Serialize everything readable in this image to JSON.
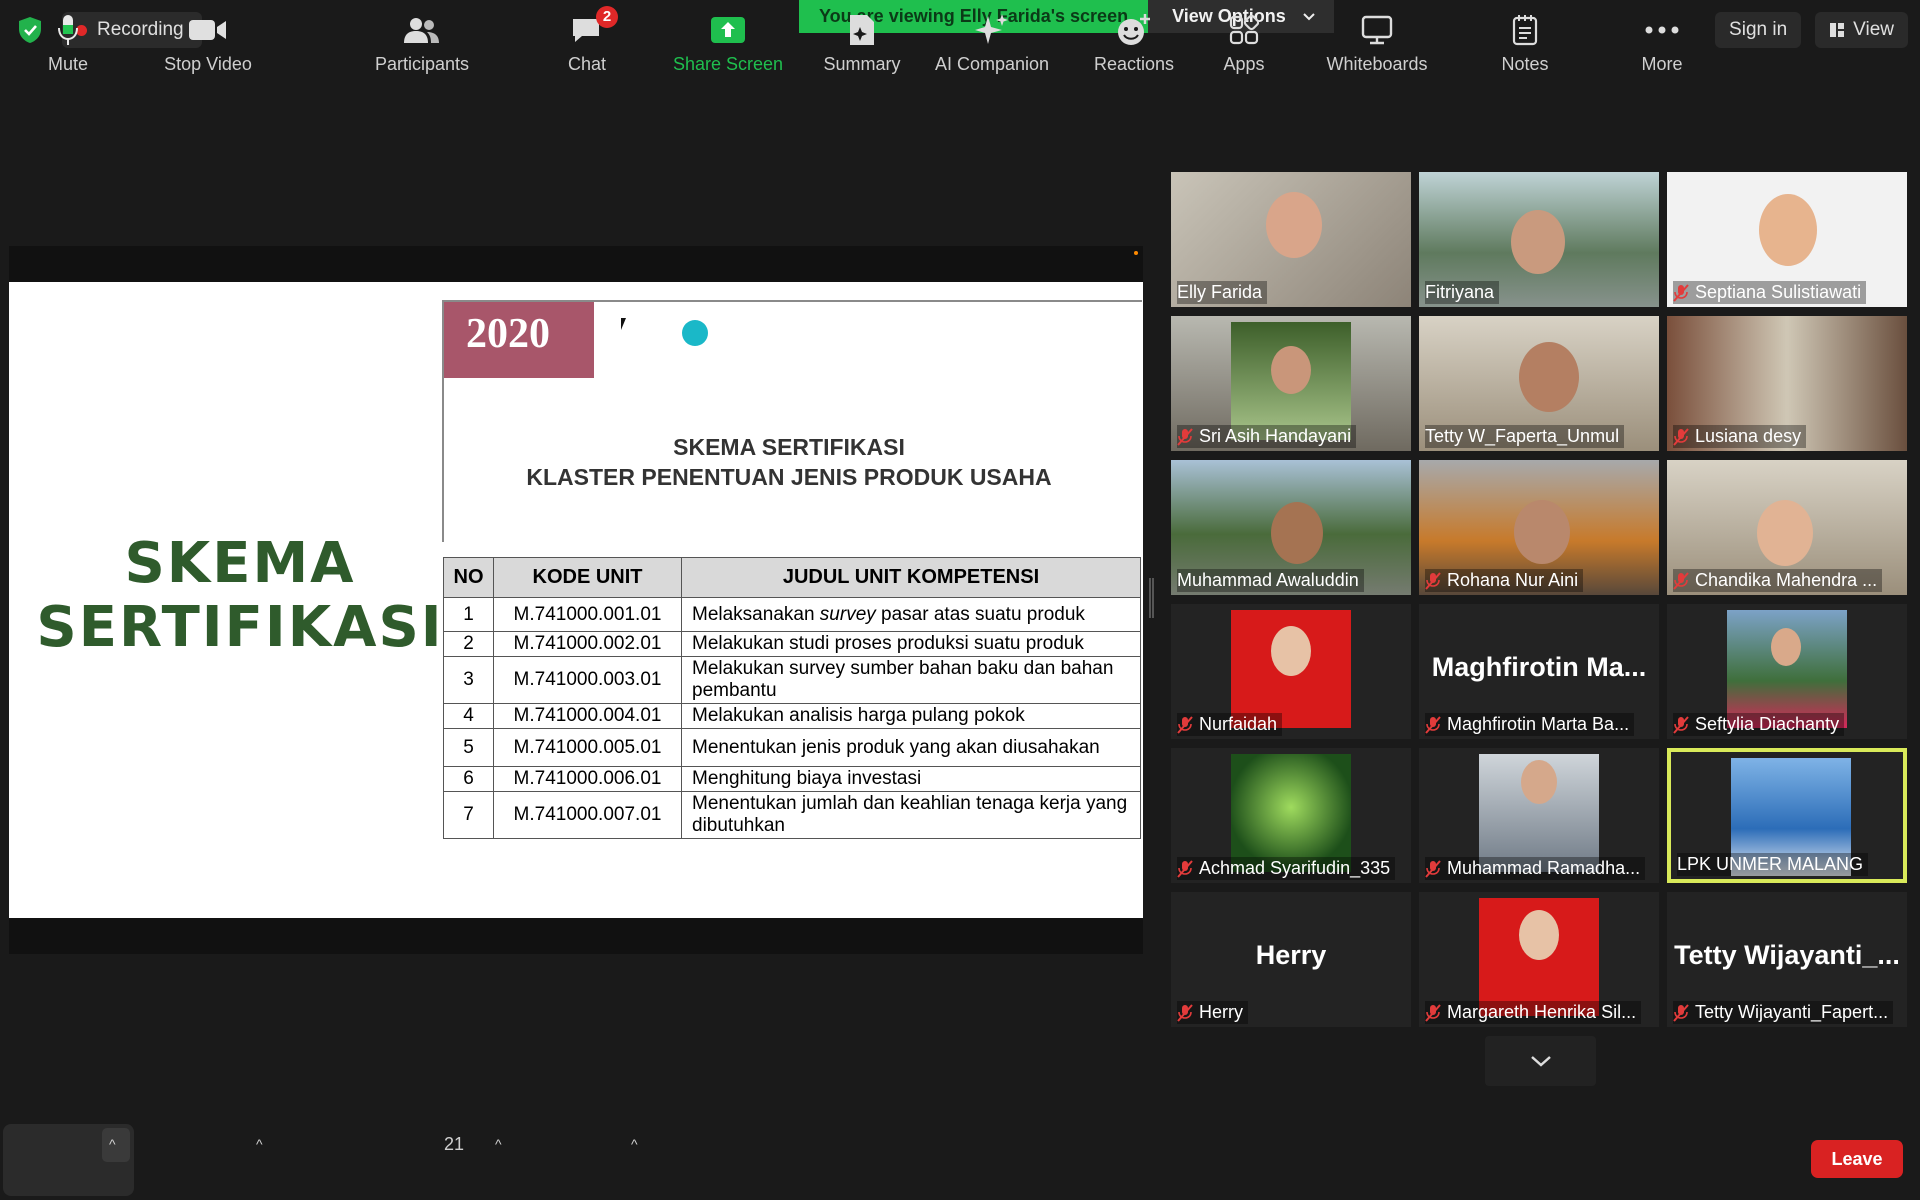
{
  "top": {
    "recording_label": "Recording",
    "banner_text": "You are viewing Elly Farida's screen",
    "view_options_label": "View Options",
    "sign_in_label": "Sign in",
    "view_label": "View"
  },
  "slide": {
    "big_title_line1": "SKEMA",
    "big_title_line2": "SERTIFIKASI",
    "year": "2020",
    "heading_line1": "SKEMA SERTIFIKASI",
    "heading_line2": "KLASTER PENENTUAN JENIS PRODUK USAHA",
    "table_headers": [
      "NO",
      "KODE UNIT",
      "JUDUL UNIT KOMPETENSI"
    ],
    "rows": [
      {
        "no": "1",
        "kode": "M.741000.001.01",
        "judul_pre": "Melaksanakan ",
        "judul_em": "survey",
        "judul_post": " pasar atas suatu produk"
      },
      {
        "no": "2",
        "kode": "M.741000.002.01",
        "judul_pre": "Melakukan studi proses produksi suatu produk",
        "judul_em": "",
        "judul_post": ""
      },
      {
        "no": "3",
        "kode": "M.741000.003.01",
        "judul_pre": "Melakukan survey sumber bahan baku dan bahan pembantu",
        "judul_em": "",
        "judul_post": ""
      },
      {
        "no": "4",
        "kode": "M.741000.004.01",
        "judul_pre": "Melakukan analisis harga pulang pokok",
        "judul_em": "",
        "judul_post": ""
      },
      {
        "no": "5",
        "kode": "M.741000.005.01",
        "judul_pre": "Menentukan jenis produk yang akan diusahakan",
        "judul_em": "",
        "judul_post": ""
      },
      {
        "no": "6",
        "kode": "M.741000.006.01",
        "judul_pre": "Menghitung biaya investasi",
        "judul_em": "",
        "judul_post": ""
      },
      {
        "no": "7",
        "kode": "M.741000.007.01",
        "judul_pre": "Menentukan jumlah dan keahlian tenaga kerja yang dibutuhkan",
        "judul_em": "",
        "judul_post": ""
      }
    ]
  },
  "participants": [
    {
      "name": "Elly Farida",
      "big": ""
    },
    {
      "name": "Fitriyana",
      "big": ""
    },
    {
      "name": "Septiana Sulistiawati",
      "big": ""
    },
    {
      "name": "Sri Asih Handayani",
      "big": ""
    },
    {
      "name": "Tetty W_Faperta_Unmul",
      "big": ""
    },
    {
      "name": "Lusiana desy",
      "big": ""
    },
    {
      "name": "Muhammad Awaluddin",
      "big": ""
    },
    {
      "name": "Rohana Nur Aini",
      "big": ""
    },
    {
      "name": "Chandika Mahendra ...",
      "big": ""
    },
    {
      "name": "Nurfaidah",
      "big": ""
    },
    {
      "name": "Maghfirotin Marta Ba...",
      "big": "Maghfirotin  Ma..."
    },
    {
      "name": "Seftylia Diachanty",
      "big": ""
    },
    {
      "name": "Achmad Syarifudin_335",
      "big": ""
    },
    {
      "name": "Muhammad Ramadha...",
      "big": ""
    },
    {
      "name": "LPK UNMER MALANG",
      "big": ""
    },
    {
      "name": "Herry",
      "big": "Herry"
    },
    {
      "name": "Margareth Henrika Sil...",
      "big": ""
    },
    {
      "name": "Tetty Wijayanti_Fapert...",
      "big": "Tetty  Wijayanti_..."
    }
  ],
  "toolbar": {
    "mute": "Mute",
    "stop_video": "Stop Video",
    "participants": "Participants",
    "participants_count": "21",
    "chat": "Chat",
    "chat_badge": "2",
    "share_screen": "Share Screen",
    "summary": "Summary",
    "ai_companion": "AI Companion",
    "reactions": "Reactions",
    "apps": "Apps",
    "whiteboards": "Whiteboards",
    "notes": "Notes",
    "more": "More",
    "leave": "Leave"
  },
  "colors": {
    "share_green": "#1fbf4e",
    "leave_red": "#d92222",
    "active_speaker": "#d9ea5a",
    "slide_title_green": "#2f5b2c"
  }
}
